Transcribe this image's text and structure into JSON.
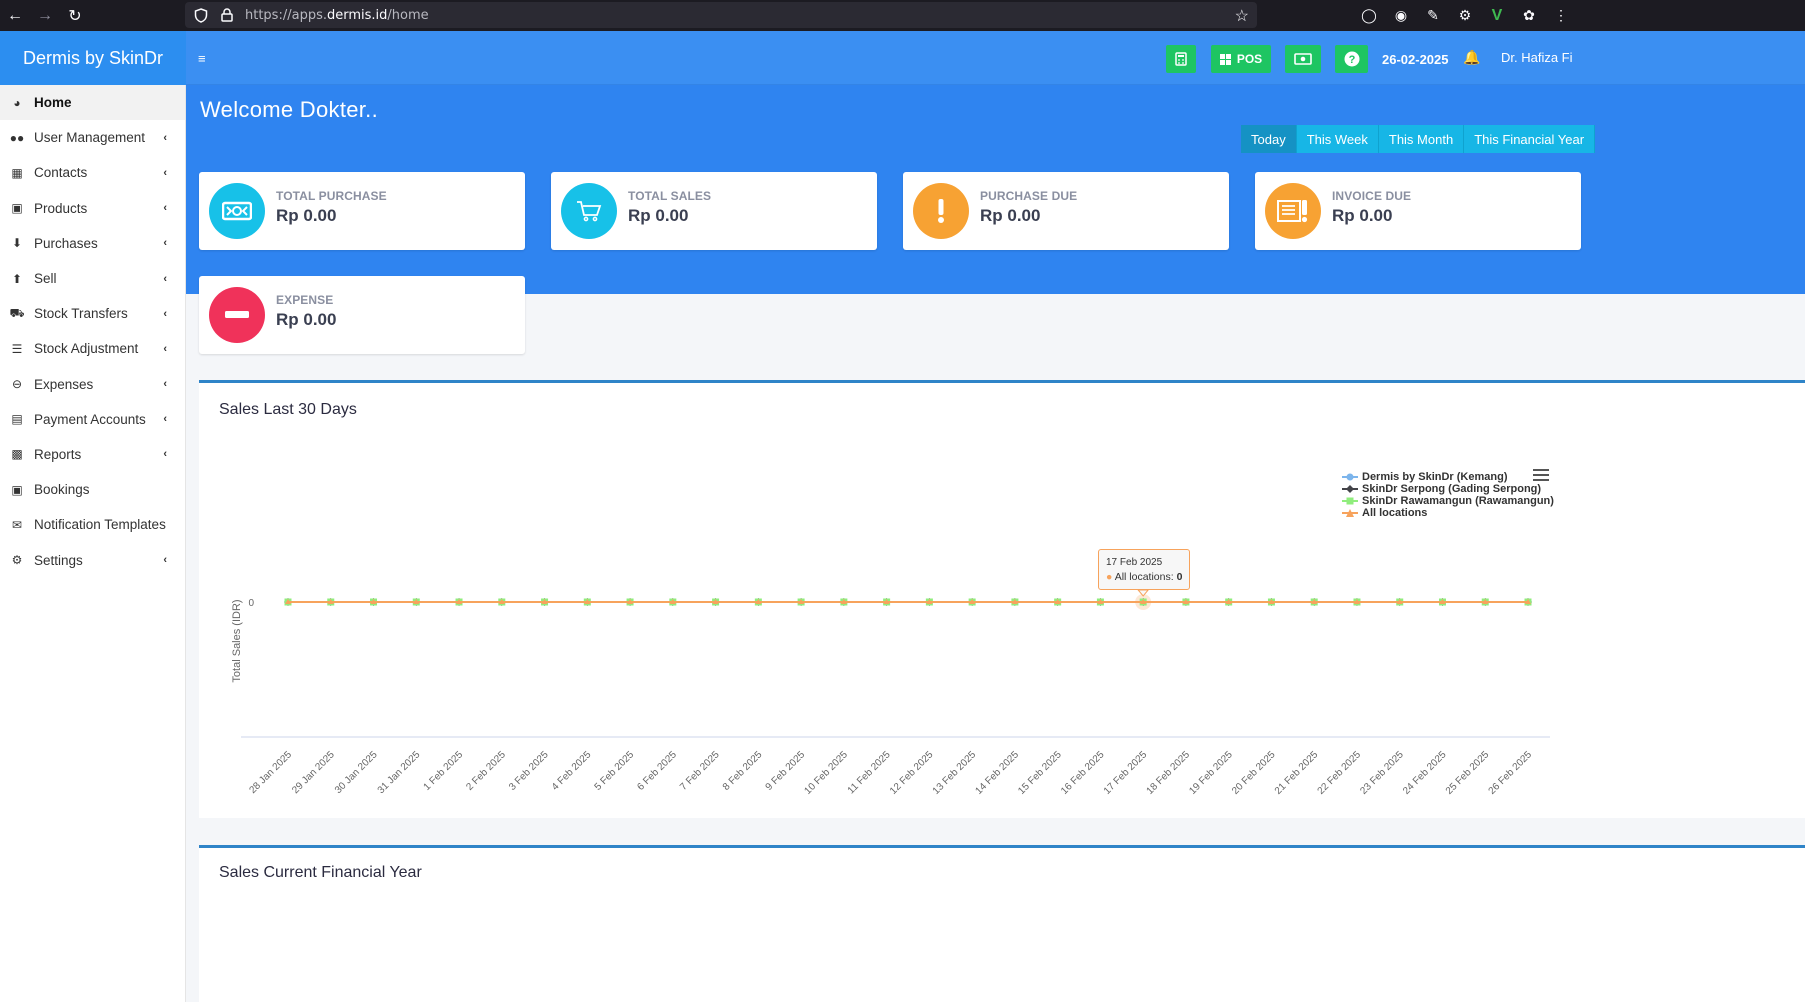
{
  "browser": {
    "url_prefix": "https://apps.",
    "url_domain": "dermis.id",
    "url_path": "/home"
  },
  "app": {
    "brand": "Dermis by SkinDr"
  },
  "topbar": {
    "pos_label": "POS",
    "date": "26-02-2025",
    "user": "Dr. Hafiza Fi"
  },
  "sidebar": {
    "items": [
      {
        "label": "Home",
        "icon": "dashboard-icon",
        "active": true,
        "has_children": false
      },
      {
        "label": "User Management",
        "icon": "users-icon",
        "has_children": true
      },
      {
        "label": "Contacts",
        "icon": "address-book-icon",
        "has_children": true
      },
      {
        "label": "Products",
        "icon": "cubes-icon",
        "has_children": true
      },
      {
        "label": "Purchases",
        "icon": "arrow-circle-down-icon",
        "has_children": true
      },
      {
        "label": "Sell",
        "icon": "arrow-circle-up-icon",
        "has_children": true
      },
      {
        "label": "Stock Transfers",
        "icon": "truck-icon",
        "has_children": true
      },
      {
        "label": "Stock Adjustment",
        "icon": "database-icon",
        "has_children": true
      },
      {
        "label": "Expenses",
        "icon": "minus-circle-icon",
        "has_children": true
      },
      {
        "label": "Payment Accounts",
        "icon": "money-check-icon",
        "has_children": true
      },
      {
        "label": "Reports",
        "icon": "bar-chart-icon",
        "has_children": true
      },
      {
        "label": "Bookings",
        "icon": "calendar-check-icon",
        "has_children": false
      },
      {
        "label": "Notification Templates",
        "icon": "envelope-icon",
        "has_children": false
      },
      {
        "label": "Settings",
        "icon": "cog-icon",
        "has_children": true
      }
    ]
  },
  "main": {
    "welcome": "Welcome Dokter..",
    "ranges": [
      "Today",
      "This Week",
      "This Month",
      "This Financial Year"
    ],
    "cards": [
      {
        "label": "TOTAL PURCHASE",
        "value": "Rp 0.00",
        "color": "#17c1e8",
        "icon": "money-bill-icon"
      },
      {
        "label": "TOTAL SALES",
        "value": "Rp 0.00",
        "color": "#17c1e8",
        "icon": "cart-icon"
      },
      {
        "label": "PURCHASE DUE",
        "value": "Rp 0.00",
        "color": "#f7a233",
        "icon": "exclamation-icon"
      },
      {
        "label": "INVOICE DUE",
        "value": "Rp 0.00",
        "color": "#f7a233",
        "icon": "invoice-alert-icon"
      },
      {
        "label": "EXPENSE",
        "value": "Rp 0.00",
        "color": "#f0325a",
        "icon": "minus-circle-icon"
      }
    ],
    "panel1_title": "Sales Last 30 Days",
    "panel2_title": "Sales Current Financial Year"
  },
  "chart_data": {
    "type": "line",
    "ylabel": "Total Sales (IDR)",
    "y_ticks": [
      "0"
    ],
    "categories": [
      "28 Jan 2025",
      "29 Jan 2025",
      "30 Jan 2025",
      "31 Jan 2025",
      "1 Feb 2025",
      "2 Feb 2025",
      "3 Feb 2025",
      "4 Feb 2025",
      "5 Feb 2025",
      "6 Feb 2025",
      "7 Feb 2025",
      "8 Feb 2025",
      "9 Feb 2025",
      "10 Feb 2025",
      "11 Feb 2025",
      "12 Feb 2025",
      "13 Feb 2025",
      "14 Feb 2025",
      "15 Feb 2025",
      "16 Feb 2025",
      "17 Feb 2025",
      "18 Feb 2025",
      "19 Feb 2025",
      "20 Feb 2025",
      "21 Feb 2025",
      "22 Feb 2025",
      "23 Feb 2025",
      "24 Feb 2025",
      "25 Feb 2025",
      "26 Feb 2025"
    ],
    "series": [
      {
        "name": "Dermis by SkinDr (Kemang)",
        "color": "#7cb5ec",
        "marker": "circle",
        "values": [
          0,
          0,
          0,
          0,
          0,
          0,
          0,
          0,
          0,
          0,
          0,
          0,
          0,
          0,
          0,
          0,
          0,
          0,
          0,
          0,
          0,
          0,
          0,
          0,
          0,
          0,
          0,
          0,
          0,
          0
        ]
      },
      {
        "name": "SkinDr Serpong (Gading Serpong)",
        "color": "#434348",
        "marker": "diamond",
        "values": [
          0,
          0,
          0,
          0,
          0,
          0,
          0,
          0,
          0,
          0,
          0,
          0,
          0,
          0,
          0,
          0,
          0,
          0,
          0,
          0,
          0,
          0,
          0,
          0,
          0,
          0,
          0,
          0,
          0,
          0
        ]
      },
      {
        "name": "SkinDr Rawamangun (Rawamangun)",
        "color": "#90ed7d",
        "marker": "square",
        "values": [
          0,
          0,
          0,
          0,
          0,
          0,
          0,
          0,
          0,
          0,
          0,
          0,
          0,
          0,
          0,
          0,
          0,
          0,
          0,
          0,
          0,
          0,
          0,
          0,
          0,
          0,
          0,
          0,
          0,
          0
        ]
      },
      {
        "name": "All locations",
        "color": "#f7a35c",
        "marker": "triangle",
        "values": [
          0,
          0,
          0,
          0,
          0,
          0,
          0,
          0,
          0,
          0,
          0,
          0,
          0,
          0,
          0,
          0,
          0,
          0,
          0,
          0,
          0,
          0,
          0,
          0,
          0,
          0,
          0,
          0,
          0,
          0
        ]
      }
    ],
    "tooltip": {
      "date": "17 Feb 2025",
      "series": "All locations",
      "value": "0"
    }
  }
}
